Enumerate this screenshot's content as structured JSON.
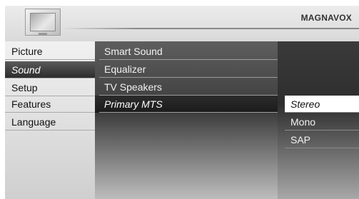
{
  "header": {
    "brand": "MAGNAVOX",
    "icon": "tv-icon"
  },
  "menu": {
    "main_items": [
      {
        "label": "Picture",
        "selected": false
      },
      {
        "label": "Sound",
        "selected": true
      },
      {
        "label": "Setup",
        "selected": false
      },
      {
        "label": "Features",
        "selected": false
      },
      {
        "label": "Language",
        "selected": false
      }
    ],
    "sound_items": [
      {
        "label": "Smart Sound",
        "selected": false
      },
      {
        "label": "Equalizer",
        "selected": false
      },
      {
        "label": "TV Speakers",
        "selected": false
      },
      {
        "label": "Primary MTS",
        "selected": true
      }
    ],
    "mts_options": [
      {
        "label": "Stereo",
        "selected": true
      },
      {
        "label": "Mono",
        "selected": false
      },
      {
        "label": "SAP",
        "selected": false
      }
    ]
  }
}
